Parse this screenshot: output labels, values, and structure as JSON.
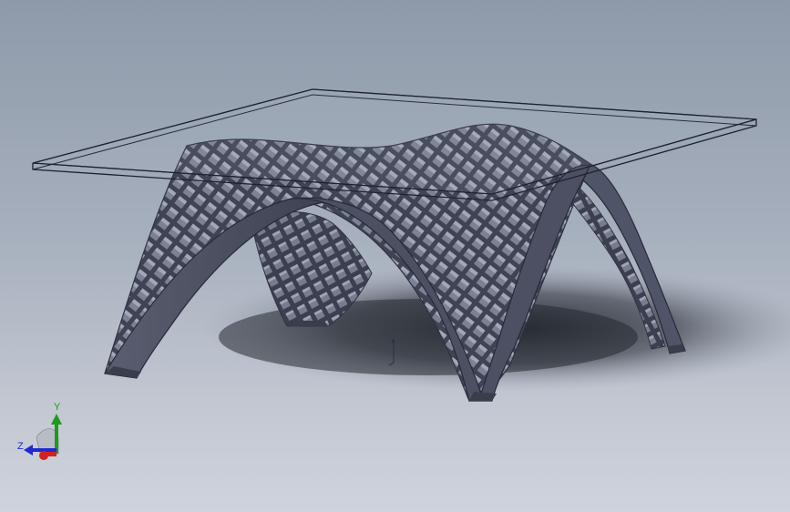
{
  "viewport": {
    "background_top": "#8e9aaa",
    "background_bottom": "#cfd3dc",
    "model_color": "#4a4e5e",
    "glass_edge_color": "#1e2230"
  },
  "model": {
    "parts": [
      "glass-top",
      "lattice-shell",
      "arch-left",
      "arch-front",
      "arch-right",
      "arch-back"
    ]
  },
  "triad": {
    "x_label": "X",
    "y_label": "Y",
    "z_label": "Z",
    "x_color": "#d42020",
    "y_color": "#1e9a1e",
    "z_color": "#1e2ad0"
  },
  "origin_marker": {
    "icon": "origin-icon"
  }
}
